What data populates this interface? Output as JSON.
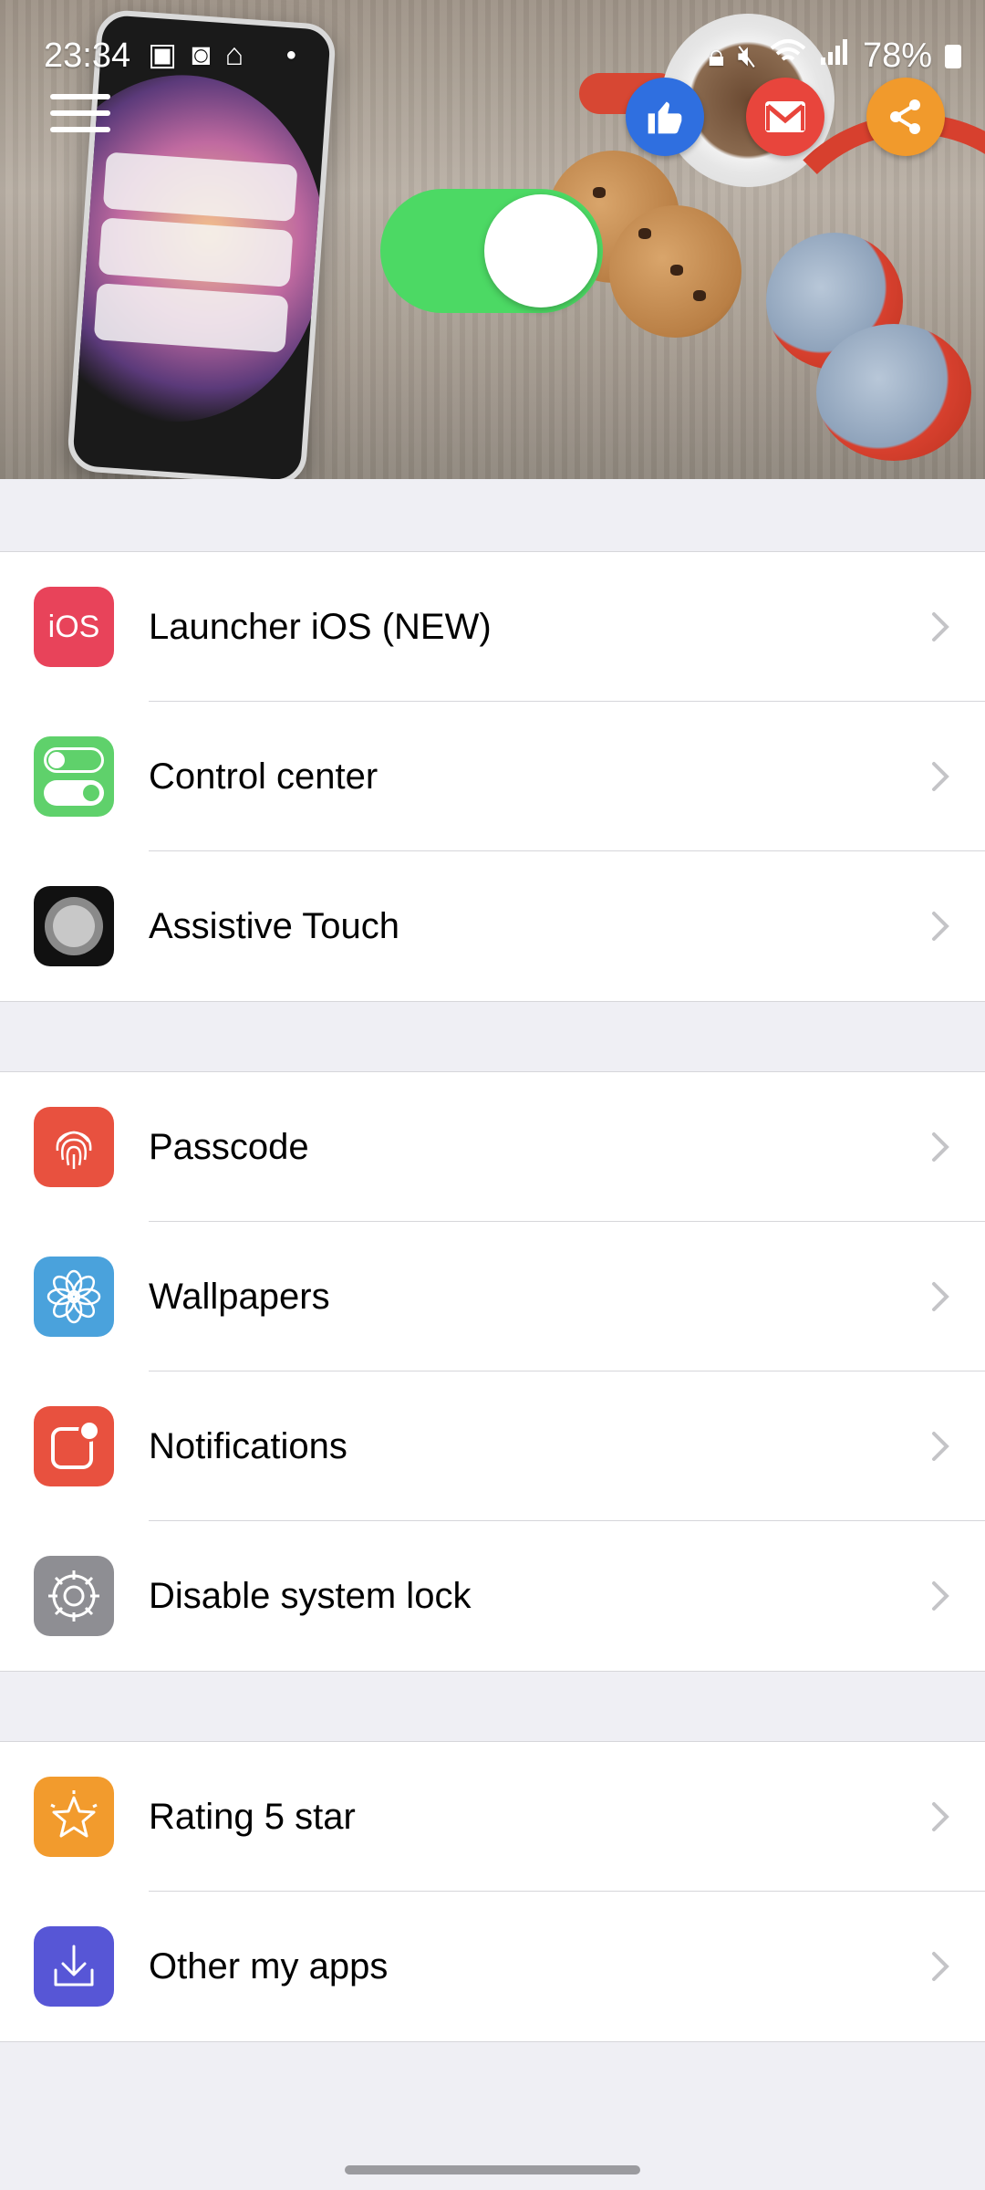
{
  "status_bar": {
    "time": "23:34",
    "battery": "78%"
  },
  "header": {
    "toggle_state": "on"
  },
  "colors": {
    "toggle": "#4cd964",
    "like_button": "#2f6fe0",
    "mail_button": "#e8453c",
    "share_button": "#f19a2c"
  },
  "sections": [
    {
      "items": [
        {
          "label": "Launcher iOS (NEW)",
          "icon": "ios-icon",
          "icon_text": "iOS",
          "color": "#e8435a"
        },
        {
          "label": "Control center",
          "icon": "toggles-icon",
          "color": "#5fd16b"
        },
        {
          "label": "Assistive Touch",
          "icon": "assistive-touch-icon",
          "color": "#111111"
        }
      ]
    },
    {
      "items": [
        {
          "label": "Passcode",
          "icon": "fingerprint-icon",
          "color": "#e8513f"
        },
        {
          "label": "Wallpapers",
          "icon": "flower-icon",
          "color": "#4aa2dc"
        },
        {
          "label": "Notifications",
          "icon": "notification-badge-icon",
          "color": "#e8513f"
        },
        {
          "label": "Disable system lock",
          "icon": "gear-icon",
          "color": "#8e8e93"
        }
      ]
    },
    {
      "items": [
        {
          "label": "Rating 5 star",
          "icon": "star-icon",
          "color": "#f29b2d"
        },
        {
          "label": "Other my apps",
          "icon": "download-icon",
          "color": "#5756d6"
        }
      ]
    }
  ]
}
